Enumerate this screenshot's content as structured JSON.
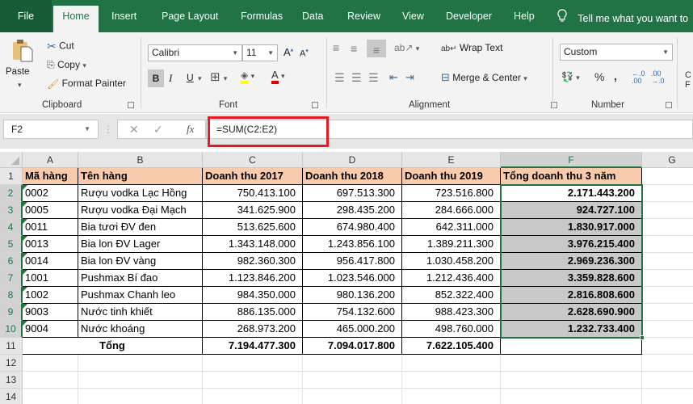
{
  "tabs": [
    {
      "label": "File"
    },
    {
      "label": "Home"
    },
    {
      "label": "Insert"
    },
    {
      "label": "Page Layout"
    },
    {
      "label": "Formulas"
    },
    {
      "label": "Data"
    },
    {
      "label": "Review"
    },
    {
      "label": "View"
    },
    {
      "label": "Developer"
    },
    {
      "label": "Help"
    }
  ],
  "active_tab": "Home",
  "tell_me": "Tell me what you want to",
  "ribbon": {
    "clipboard": {
      "label": "Clipboard",
      "paste": "Paste",
      "cut": "Cut",
      "copy": "Copy",
      "format_painter": "Format Painter"
    },
    "font": {
      "label": "Font",
      "font_name": "Calibri",
      "font_size": "11",
      "bold": "B",
      "italic": "I",
      "underline": "U"
    },
    "alignment": {
      "label": "Alignment",
      "wrap_text": "Wrap Text",
      "merge_center": "Merge & Center"
    },
    "number": {
      "label": "Number",
      "format": "Custom",
      "percent": "%",
      "comma": ","
    }
  },
  "formula_bar": {
    "name_box": "F2",
    "formula": "=SUM(C2:E2)"
  },
  "columns": [
    "A",
    "B",
    "C",
    "D",
    "E",
    "F",
    "G"
  ],
  "selected_column": "F",
  "row_numbers": [
    "1",
    "2",
    "3",
    "4",
    "5",
    "6",
    "7",
    "8",
    "9",
    "10",
    "11",
    "12",
    "13",
    "14"
  ],
  "headers": [
    "Mã hàng",
    "Tên hàng",
    "Doanh thu 2017",
    "Doanh thu 2018",
    "Doanh thu 2019",
    "Tổng doanh thu 3 năm"
  ],
  "rows": [
    [
      "0002",
      "Rượu vodka Lạc Hồng",
      "750.413.100",
      "697.513.300",
      "723.516.800",
      "2.171.443.200"
    ],
    [
      "0005",
      "Rượu vodka Đại Mạch",
      "341.625.900",
      "298.435.200",
      "284.666.000",
      "924.727.100"
    ],
    [
      "0011",
      "Bia tươi ĐV đen",
      "513.625.600",
      "674.980.400",
      "642.311.000",
      "1.830.917.000"
    ],
    [
      "0013",
      "Bia lon ĐV Lager",
      "1.343.148.000",
      "1.243.856.100",
      "1.389.211.300",
      "3.976.215.400"
    ],
    [
      "0014",
      "Bia lon ĐV vàng",
      "982.360.300",
      "956.417.800",
      "1.030.458.200",
      "2.969.236.300"
    ],
    [
      "1001",
      "Pushmax Bí đao",
      "1.123.846.200",
      "1.023.546.000",
      "1.212.436.400",
      "3.359.828.600"
    ],
    [
      "1002",
      "Pushmax Chanh leo",
      "984.350.000",
      "980.136.200",
      "852.322.400",
      "2.816.808.600"
    ],
    [
      "9003",
      "Nước tinh khiết",
      "886.135.000",
      "754.132.600",
      "988.423.300",
      "2.628.690.900"
    ],
    [
      "9004",
      "Nước khoáng",
      "268.973.200",
      "465.000.200",
      "498.760.000",
      "1.232.733.400"
    ]
  ],
  "total_row": {
    "label": "Tổng",
    "values": [
      "7.194.477.300",
      "7.094.017.800",
      "7.622.105.400",
      ""
    ]
  },
  "colors": {
    "brand": "#217346",
    "header_fill": "#f8cbad",
    "selection_fill": "#c8c8c8",
    "highlight": "#e31c23"
  }
}
